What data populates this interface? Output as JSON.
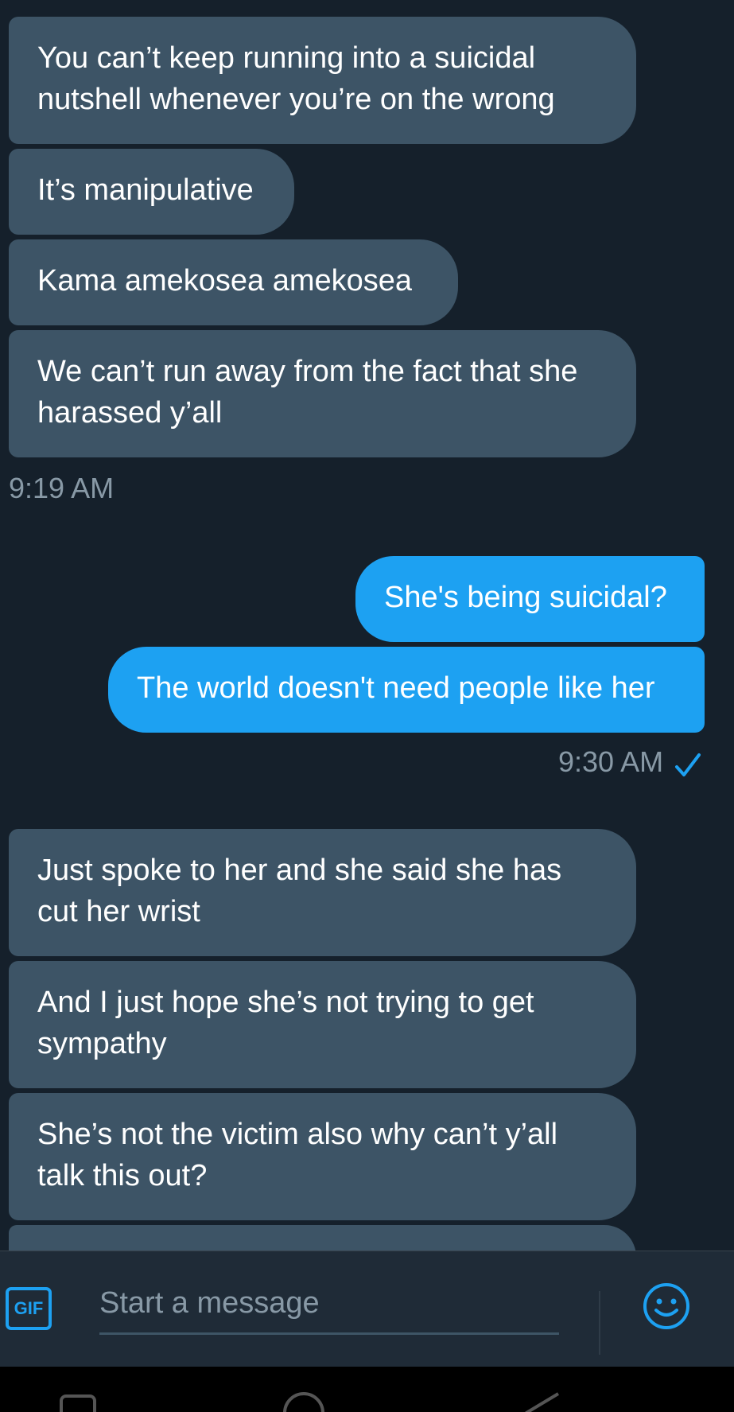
{
  "messages": [
    {
      "text": "You can’t keep running into a suicidal nutshell whenever you’re on the wrong"
    },
    {
      "text": "It’s manipulative"
    },
    {
      "text": "Kama amekosea amekosea"
    },
    {
      "text": "We can’t run away from the fact that she harassed y’all"
    },
    {
      "text": "She's being suicidal?"
    },
    {
      "text": "The world doesn't need people like her"
    },
    {
      "text": "Just spoke to her and she said she has cut her wrist"
    },
    {
      "text": "And I just hope she’s not trying to get sympathy"
    },
    {
      "text": "She’s not the victim also why can’t y’all talk this out?"
    }
  ],
  "timestamps": {
    "incoming_1": "9:19 AM",
    "outgoing_1": "9:30 AM"
  },
  "composer": {
    "gif_label": "GIF",
    "placeholder": "Start a message"
  },
  "icons": {
    "read_receipt": "checkmark-icon",
    "emoji": "smiley-icon",
    "nav_home": "circle-icon",
    "nav_recents": "square-icon",
    "nav_back": "triangle-icon"
  },
  "colors": {
    "background": "#15202b",
    "incoming_bubble": "#3d5466",
    "outgoing_bubble": "#1da1f2",
    "accent": "#1da1f2",
    "secondary_text": "#8899a6"
  }
}
